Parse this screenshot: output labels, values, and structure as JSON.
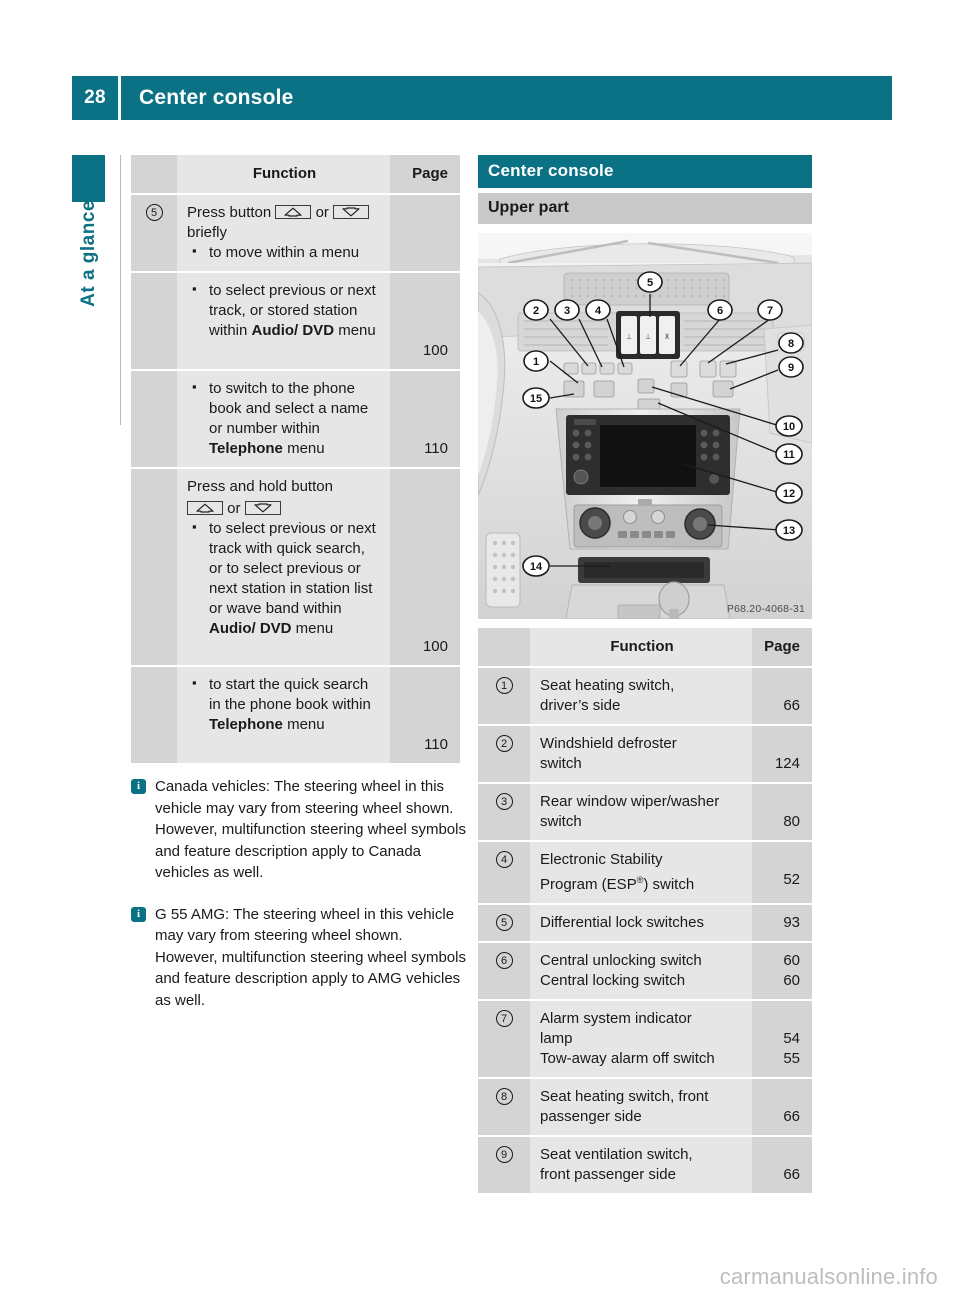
{
  "header": {
    "page_number": "28",
    "title": "Center console"
  },
  "sidebar": {
    "chapter_label": "At a glance"
  },
  "colors": {
    "accent_teal": "#0b7185",
    "table_index_gray": "#d4d4d4",
    "table_text_gray": "#e6e6e6",
    "subhead_gray": "#c9c9c9"
  },
  "left_table": {
    "headers": {
      "index": "",
      "function": "Function",
      "page": "Page"
    },
    "rows": [
      {
        "index": "5",
        "intro": "Press button",
        "key_1": "arrow-up-key",
        "key_sep": "or",
        "key_2": "arrow-down-key",
        "intro_after": "briefly",
        "bullets": [
          {
            "text": "to move within a menu",
            "page": ""
          }
        ]
      },
      {
        "index": "",
        "bullets": [
          {
            "text_parts": [
              "to select previous or next track, or stored station within ",
              "Audio/ DVD",
              " menu"
            ],
            "page": "100"
          }
        ]
      },
      {
        "index": "",
        "bullets": [
          {
            "text_parts": [
              "to switch to the phone book and select a name or number within ",
              "Telephone",
              " menu"
            ],
            "page": "110"
          }
        ]
      },
      {
        "index": "",
        "intro": "Press and hold button",
        "key_1": "arrow-up-key",
        "key_sep": "or",
        "key_2": "arrow-down-key",
        "bullets": [
          {
            "text_parts": [
              "to select previous or next track with quick search, or to select previous or next station in station list or wave band within ",
              "Audio/ DVD",
              " menu"
            ],
            "page": "100"
          }
        ]
      },
      {
        "index": "",
        "bullets": [
          {
            "text_parts": [
              "to start the quick search in the phone book within ",
              "Telephone",
              " menu"
            ],
            "page": "110"
          }
        ]
      }
    ]
  },
  "notes": [
    {
      "icon": "info-icon",
      "text": "Canada vehicles: The steering wheel in this vehicle may vary from steering wheel shown. However, multifunction steering wheel symbols and feature description apply to Canada vehicles as well."
    },
    {
      "icon": "info-icon",
      "text": "G 55 AMG: The steering wheel in this vehicle may vary from steering wheel shown. However, multifunction steering wheel symbols and feature description apply to AMG vehicles as well."
    }
  ],
  "right_column": {
    "section_title": "Center console",
    "subsection_title": "Upper part",
    "illustration": {
      "name": "center-console-upper-part-diagram",
      "caption": "P68.20-4068-31",
      "callouts": [
        "1",
        "2",
        "3",
        "4",
        "5",
        "6",
        "7",
        "8",
        "9",
        "10",
        "11",
        "12",
        "13",
        "14",
        "15"
      ]
    },
    "table": {
      "headers": {
        "index": "",
        "function": "Function",
        "page": "Page"
      },
      "rows": [
        {
          "index": "1",
          "lines": [
            {
              "text": "Seat heating switch,",
              "page": ""
            },
            {
              "text": "driver’s side",
              "page": "66"
            }
          ]
        },
        {
          "index": "2",
          "lines": [
            {
              "text": "Windshield defroster",
              "page": ""
            },
            {
              "text": "switch",
              "page": "124"
            }
          ]
        },
        {
          "index": "3",
          "lines": [
            {
              "text": "Rear window wiper/washer",
              "page": ""
            },
            {
              "text": "switch",
              "page": "80"
            }
          ]
        },
        {
          "index": "4",
          "lines": [
            {
              "text": "Electronic Stability",
              "page": ""
            },
            {
              "text": "Program (ESP®) switch",
              "page": "52"
            }
          ]
        },
        {
          "index": "5",
          "lines": [
            {
              "text": "Differential lock switches",
              "page": "93"
            }
          ]
        },
        {
          "index": "6",
          "lines": [
            {
              "text": "Central unlocking switch",
              "page": "60"
            },
            {
              "text": "Central locking switch",
              "page": "60"
            }
          ]
        },
        {
          "index": "7",
          "lines": [
            {
              "text": "Alarm system indicator",
              "page": ""
            },
            {
              "text": "lamp",
              "page": "54"
            },
            {
              "text": "Tow-away alarm off switch",
              "page": "55"
            }
          ]
        },
        {
          "index": "8",
          "lines": [
            {
              "text": "Seat heating switch, front",
              "page": ""
            },
            {
              "text": "passenger side",
              "page": "66"
            }
          ]
        },
        {
          "index": "9",
          "lines": [
            {
              "text": "Seat ventilation switch,",
              "page": ""
            },
            {
              "text": "front passenger side",
              "page": "66"
            }
          ]
        }
      ]
    }
  },
  "footer": {
    "watermark": "carmanualsonline.info"
  }
}
